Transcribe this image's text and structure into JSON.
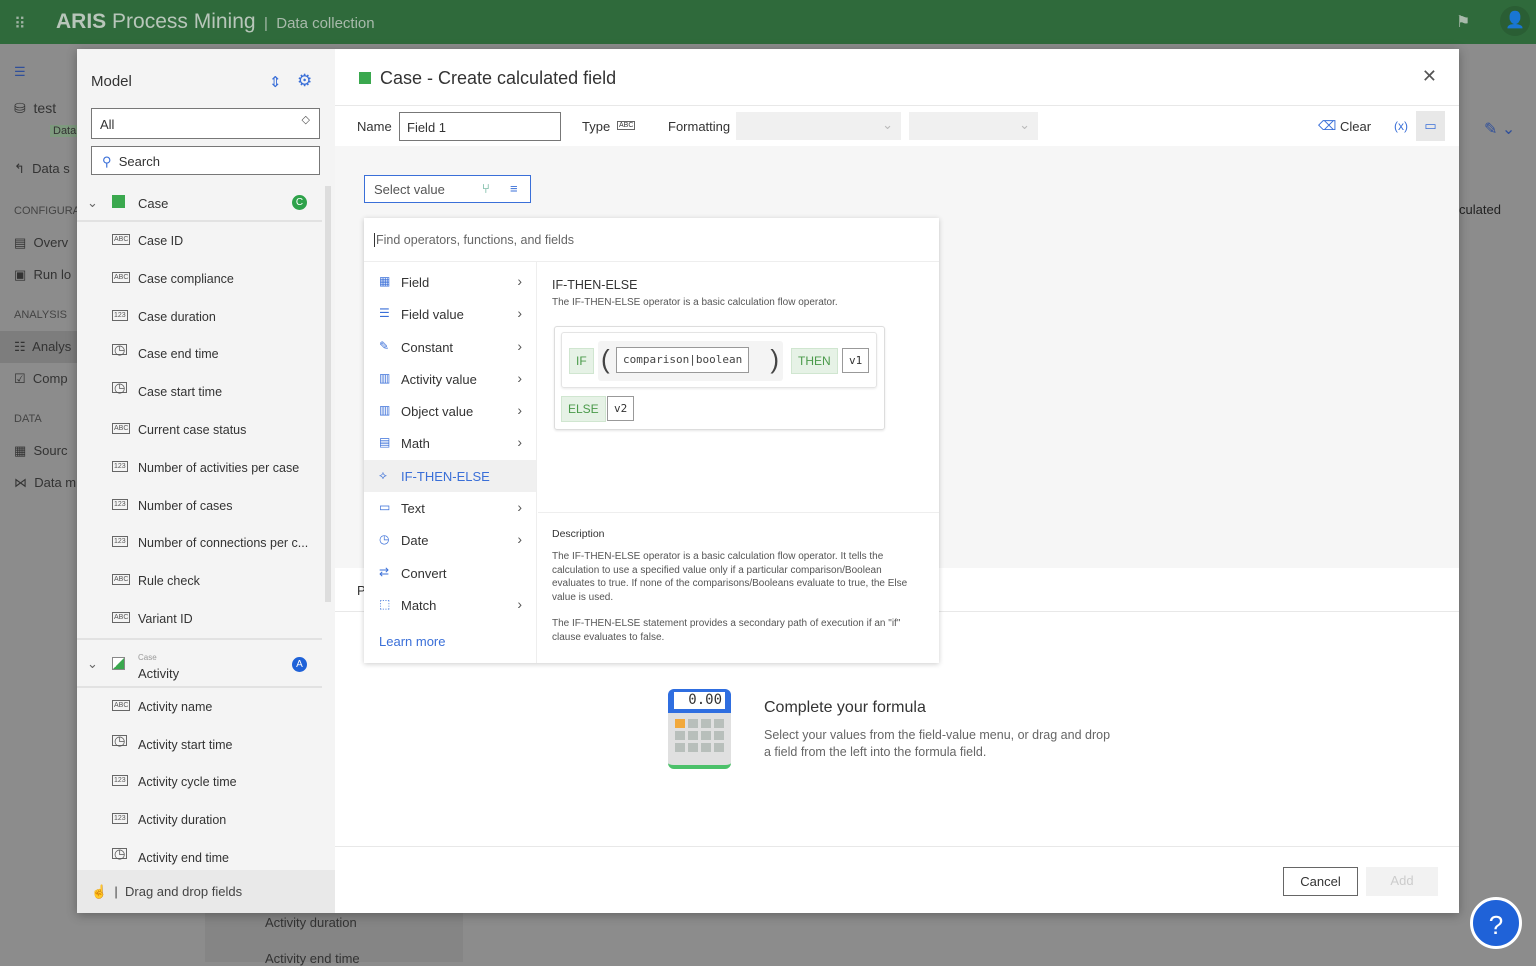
{
  "app": {
    "brand_bold": "ARIS",
    "brand_rest": "Process Mining",
    "section": "Data collection"
  },
  "bg_sidebar": {
    "project": "test",
    "project_tag": "Data",
    "back": "Data s",
    "sec_config": "CONFIGURA",
    "overview": "Overv",
    "run": "Run lo",
    "sec_analysis": "ANALYSIS",
    "analysis": "Analys",
    "compliance": "Comp",
    "sec_data": "DATA",
    "source": "Sourc",
    "datamodel": "Data m"
  },
  "bg_main": {
    "calculated": "culated",
    "bottom_items": [
      "Activity duration",
      "Activity end time"
    ]
  },
  "model": {
    "title": "Model",
    "filter": "All",
    "search_placeholder": "Search",
    "groups": [
      {
        "label": "Case",
        "badge": "C",
        "badge_color": "#2ea24a",
        "items": [
          {
            "label": "Case ID",
            "type": "ABC"
          },
          {
            "label": "Case compliance",
            "type": "ABC"
          },
          {
            "label": "Case duration",
            "type": "123"
          },
          {
            "label": "Case end time",
            "type": "date"
          },
          {
            "label": "Case start time",
            "type": "date"
          },
          {
            "label": "Current case status",
            "type": "ABC"
          },
          {
            "label": "Number of activities per case",
            "type": "123"
          },
          {
            "label": "Number of cases",
            "type": "123"
          },
          {
            "label": "Number of connections per c...",
            "type": "123"
          },
          {
            "label": "Rule check",
            "type": "ABC"
          },
          {
            "label": "Variant ID",
            "type": "ABC"
          }
        ]
      },
      {
        "parent": "Case",
        "label": "Activity",
        "badge": "A",
        "badge_color": "#1f62d8",
        "items": [
          {
            "label": "Activity name",
            "type": "ABC"
          },
          {
            "label": "Activity start time",
            "type": "date"
          },
          {
            "label": "Activity cycle time",
            "type": "123"
          },
          {
            "label": "Activity duration",
            "type": "123"
          },
          {
            "label": "Activity end time",
            "type": "date"
          }
        ]
      }
    ],
    "drag_hint": "Drag and drop fields"
  },
  "dialog": {
    "title": "Case - Create calculated field",
    "name_label": "Name",
    "name_value": "Field 1",
    "type_label": "Type",
    "type_value": "ABC",
    "formatting_label": "Formatting",
    "clear": "Clear",
    "variables": "(x)",
    "select_value": "Select value",
    "p_label": "P",
    "finder_placeholder": "Find operators, functions, and fields",
    "menu": [
      {
        "label": "Field",
        "icon": "table-icon",
        "sub": true
      },
      {
        "label": "Field value",
        "icon": "list-search-icon",
        "sub": true
      },
      {
        "label": "Constant",
        "icon": "pen-icon",
        "sub": true
      },
      {
        "label": "Activity value",
        "icon": "grid-icon",
        "sub": true
      },
      {
        "label": "Object value",
        "icon": "grid-icon",
        "sub": true
      },
      {
        "label": "Math",
        "icon": "calculator-icon",
        "sub": true
      },
      {
        "label": "IF-THEN-ELSE",
        "icon": "flow-icon",
        "sub": false,
        "active": true
      },
      {
        "label": "Text",
        "icon": "abc-icon",
        "sub": true
      },
      {
        "label": "Date",
        "icon": "calendar-icon",
        "sub": true
      },
      {
        "label": "Convert",
        "icon": "convert-icon",
        "sub": false
      },
      {
        "label": "Match",
        "icon": "match-icon",
        "sub": true
      }
    ],
    "learn_more": "Learn more",
    "detail": {
      "title": "IF-THEN-ELSE",
      "summary": "The IF-THEN-ELSE operator is a basic calculation flow operator.",
      "kw_if": "IF",
      "placeholder": "comparison|boolean",
      "kw_then": "THEN",
      "v1": "v1",
      "kw_else": "ELSE",
      "v2": "v2",
      "desc_title": "Description",
      "desc_p1": "The IF-THEN-ELSE operator is a basic calculation flow operator. It tells the calculation to use a specified value only if a particular comparison/Boolean evaluates to true. If none of the comparisons/Booleans evaluate to true, the Else value is used.",
      "desc_p2": "The IF-THEN-ELSE statement provides a secondary path of execution if an \"if\" clause evaluates to false."
    },
    "empty": {
      "display": "0.00",
      "title": "Complete your formula",
      "text": "Select your values from the field-value menu, or drag and drop a field from the left into the formula field."
    },
    "cancel": "Cancel",
    "add": "Add"
  },
  "colors": {
    "brand": "#2f6a3b",
    "accent": "#3a6fd8",
    "keyword_green": "#4a9a4a"
  }
}
